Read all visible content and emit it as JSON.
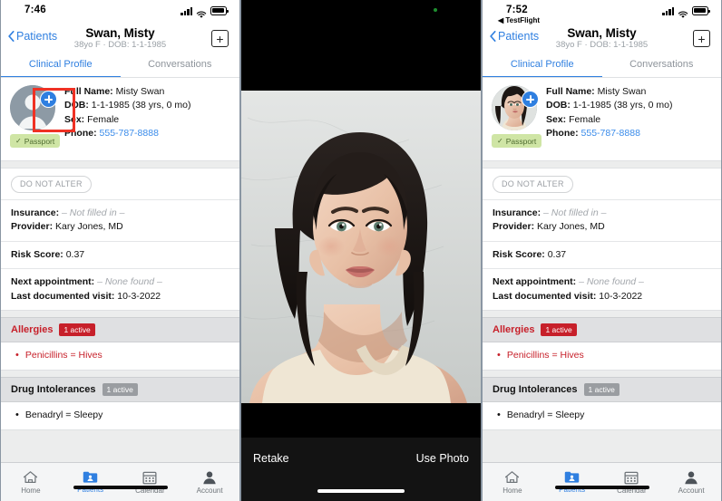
{
  "panels": {
    "left": {
      "status": {
        "time": "7:46",
        "testflight": ""
      },
      "nav": {
        "back": "Patients",
        "title": "Swan, Misty",
        "subtitle": "38yo F · DOB: 1-1-1985",
        "add_icon": "+"
      }
    },
    "right": {
      "status": {
        "time": "7:52",
        "testflight": "◀ TestFlight"
      },
      "nav": {
        "back": "Patients",
        "title": "Swan, Misty",
        "subtitle": "38yo F · DOB: 1-1-1985",
        "add_icon": "+"
      }
    }
  },
  "tabs": [
    {
      "label": "Clinical Profile",
      "active": true
    },
    {
      "label": "Conversations",
      "active": false
    }
  ],
  "patient": {
    "passport_badge": "Passport",
    "passport_check": "✓",
    "lines": [
      {
        "label": "Full Name:",
        "value": "Misty Swan",
        "link": false
      },
      {
        "label": "DOB:",
        "value": "1-1-1985 (38 yrs, 0 mo)",
        "link": false
      },
      {
        "label": "Sex:",
        "value": "Female",
        "link": false
      },
      {
        "label": "Phone:",
        "value": "555-787-8888",
        "link": true
      }
    ]
  },
  "details": {
    "do_not_alter": "DO NOT ALTER",
    "insurance_label": "Insurance:",
    "insurance_value": "– Not filled in –",
    "provider_label": "Provider:",
    "provider_value": "Kary Jones, MD",
    "risk_label": "Risk Score:",
    "risk_value": "0.37",
    "next_appt_label": "Next appointment:",
    "next_appt_value": "– None found –",
    "last_visit_label": "Last documented visit:",
    "last_visit_value": "10-3-2022"
  },
  "allergies": {
    "title": "Allergies",
    "badge": "1 active",
    "items": [
      "Penicillins = Hives"
    ]
  },
  "intolerances": {
    "title": "Drug Intolerances",
    "badge": "1 active",
    "items": [
      "Benadryl = Sleepy"
    ]
  },
  "tabbar": [
    {
      "label": "Home",
      "icon": "home-icon",
      "active": false
    },
    {
      "label": "Patients",
      "icon": "patients-folder-icon",
      "active": true
    },
    {
      "label": "Calendar",
      "icon": "calendar-icon",
      "active": false
    },
    {
      "label": "Account",
      "icon": "account-person-icon",
      "active": false
    }
  ],
  "camera": {
    "retake": "Retake",
    "use_photo": "Use Photo"
  },
  "colors": {
    "accent": "#2f7fe0",
    "alert": "#c7202a",
    "annotation": "#ef3124",
    "passport": "#cfe5a5"
  }
}
